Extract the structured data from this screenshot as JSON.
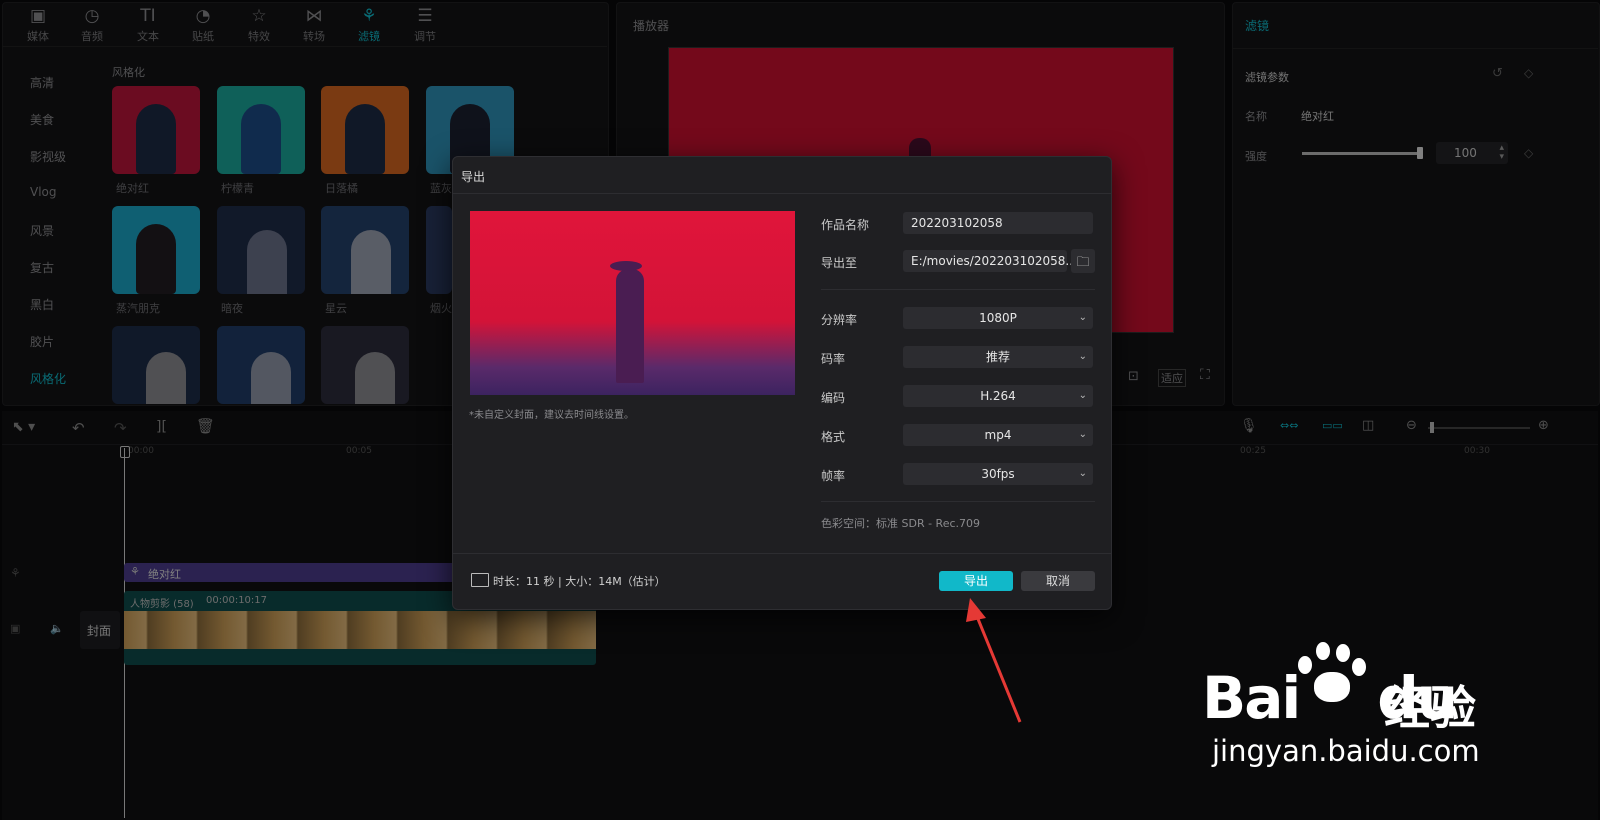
{
  "toolbar": {
    "tabs": [
      {
        "label": "媒体",
        "icon": "media-icon"
      },
      {
        "label": "音频",
        "icon": "audio-icon"
      },
      {
        "label": "文本",
        "icon": "text-icon"
      },
      {
        "label": "贴纸",
        "icon": "sticker-icon"
      },
      {
        "label": "特效",
        "icon": "effects-icon"
      },
      {
        "label": "转场",
        "icon": "transition-icon"
      },
      {
        "label": "滤镜",
        "icon": "filter-icon"
      },
      {
        "label": "调节",
        "icon": "adjust-icon"
      }
    ],
    "active_tab": "滤镜"
  },
  "filter_sidebar": {
    "items": [
      "高清",
      "美食",
      "影视级",
      "Vlog",
      "风景",
      "复古",
      "黑白",
      "胶片",
      "风格化"
    ],
    "active": "风格化"
  },
  "filter_grid": {
    "section_title": "风格化",
    "items": [
      "绝对红",
      "柠檬青",
      "日落橘",
      "蓝灰",
      "蒸汽朋克",
      "暗夜",
      "星云",
      "烟火"
    ]
  },
  "player": {
    "title": "播放器",
    "ratio_button": "适应"
  },
  "inspector": {
    "tab": "滤镜",
    "section": "滤镜参数",
    "name_label": "名称",
    "name_value": "绝对红",
    "strength_label": "强度",
    "strength_value": "100",
    "strength_fraction": 1.0
  },
  "timeline": {
    "ruler": [
      "00:00",
      "00:05",
      "00:25",
      "00:30"
    ],
    "filter_clip": "绝对红",
    "video_clip_name": "人物剪影 (58)",
    "video_clip_duration": "00:00:10:17",
    "cover_label": "封面"
  },
  "export_dialog": {
    "title": "导出",
    "cover_hint": "*未自定义封面，建议去时间线设置。",
    "fields": {
      "name_label": "作品名称",
      "name_value": "202203102058",
      "path_label": "导出至",
      "path_value": "E:/movies/202203102058...",
      "resolution_label": "分辨率",
      "resolution_value": "1080P",
      "bitrate_label": "码率",
      "bitrate_value": "推荐",
      "codec_label": "编码",
      "codec_value": "H.264",
      "format_label": "格式",
      "format_value": "mp4",
      "fps_label": "帧率",
      "fps_value": "30fps"
    },
    "color_space": "色彩空间：标准 SDR - Rec.709",
    "summary": "时长：11 秒 | 大小：14M（估计）",
    "export_button": "导出",
    "cancel_button": "取消"
  },
  "watermark": {
    "brand": "Bai",
    "brand_tail": "du",
    "cn": "经验",
    "url": "jingyan.baidu.com"
  },
  "colors": {
    "accent": "#11b8c9",
    "red_filter": "#d4153a",
    "arrow": "#e53935"
  }
}
